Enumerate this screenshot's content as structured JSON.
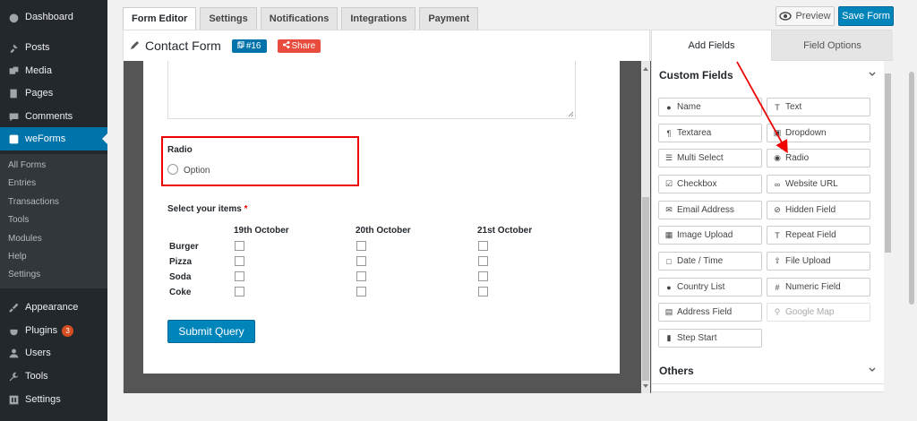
{
  "sidebar": {
    "items": [
      {
        "label": "Dashboard",
        "icon": "dashboard-icon"
      },
      {
        "label": "Posts",
        "icon": "pin-icon"
      },
      {
        "label": "Media",
        "icon": "media-icon"
      },
      {
        "label": "Pages",
        "icon": "pages-icon"
      },
      {
        "label": "Comments",
        "icon": "comment-icon"
      },
      {
        "label": "weForms",
        "icon": "weforms-icon"
      },
      {
        "label": "Appearance",
        "icon": "brush-icon"
      },
      {
        "label": "Plugins",
        "icon": "plugin-icon",
        "badge": "3"
      },
      {
        "label": "Users",
        "icon": "users-icon"
      },
      {
        "label": "Tools",
        "icon": "wrench-icon"
      },
      {
        "label": "Settings",
        "icon": "settings-icon"
      }
    ],
    "submenu": [
      "All Forms",
      "Entries",
      "Transactions",
      "Tools",
      "Modules",
      "Help",
      "Settings"
    ]
  },
  "toolbar": {
    "tabs": [
      "Form Editor",
      "Settings",
      "Notifications",
      "Integrations",
      "Payment"
    ],
    "preview_label": "Preview",
    "save_label": "Save Form"
  },
  "form": {
    "title": "Contact Form",
    "id_badge": "#16",
    "share_label": "Share",
    "radio_label": "Radio",
    "radio_option": "Option",
    "grid_label": "Select your items",
    "grid_required": "*",
    "grid_columns": [
      "19th October",
      "20th October",
      "21st October"
    ],
    "grid_rows": [
      "Burger",
      "Pizza",
      "Soda",
      "Coke"
    ],
    "submit_label": "Submit Query"
  },
  "right_panel": {
    "tabs": [
      "Add Fields",
      "Field Options"
    ],
    "custom_fields_title": "Custom Fields",
    "others_title": "Others",
    "fields": [
      {
        "label": "Name",
        "icon": "user-icon"
      },
      {
        "label": "Text",
        "icon": "text-icon"
      },
      {
        "label": "Textarea",
        "icon": "paragraph-icon"
      },
      {
        "label": "Dropdown",
        "icon": "dropdown-icon"
      },
      {
        "label": "Multi Select",
        "icon": "list-icon"
      },
      {
        "label": "Radio",
        "icon": "radio-icon"
      },
      {
        "label": "Checkbox",
        "icon": "checkbox-icon"
      },
      {
        "label": "Website URL",
        "icon": "link-icon"
      },
      {
        "label": "Email Address",
        "icon": "envelope-icon"
      },
      {
        "label": "Hidden Field",
        "icon": "eye-slash-icon"
      },
      {
        "label": "Image Upload",
        "icon": "image-icon"
      },
      {
        "label": "Repeat Field",
        "icon": "repeat-icon"
      },
      {
        "label": "Date / Time",
        "icon": "calendar-icon"
      },
      {
        "label": "File Upload",
        "icon": "upload-icon"
      },
      {
        "label": "Country List",
        "icon": "globe-icon"
      },
      {
        "label": "Numeric Field",
        "icon": "hash-icon"
      },
      {
        "label": "Address Field",
        "icon": "address-card-icon"
      },
      {
        "label": "Google Map",
        "icon": "map-marker-icon",
        "disabled": true
      },
      {
        "label": "Step Start",
        "icon": "step-icon"
      }
    ]
  },
  "colors": {
    "sidebar_bg": "#23282d",
    "accent": "#0073aa",
    "share": "#e74c3c",
    "highlight": "#e00000"
  }
}
